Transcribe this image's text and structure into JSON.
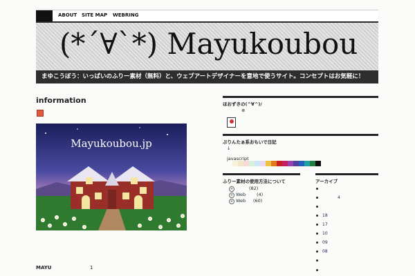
{
  "nav": {
    "items": [
      "ABOUT",
      "SITE MAP",
      "WEBRING"
    ]
  },
  "header": {
    "title": "(*´∀`*) Mayukoubou",
    "tagline": "まゆこうぼう：いっぱいのふりー素材（無料）と、ウェブアートデザイナーを意地で使うサイト。コンセプトはお気軽に！"
  },
  "main": {
    "heading": "information",
    "hero_text": "Mayukoubou.jp",
    "footer_label": "MAYU",
    "footer_num": "1"
  },
  "sidebar": {
    "widget1": {
      "title": "ほおずきの(^∀^)/",
      "plus": "⊕"
    },
    "widget2": {
      "title": "ぷりんたぁ系おもいで日記",
      "arrow": "↓",
      "script_label": "javascript"
    },
    "swatch_colors": [
      "#f6f2d8",
      "#f2e6c8",
      "#f9d8d8",
      "#d8f0d8",
      "#cfe6f6",
      "#e8d8f0",
      "#f0c040",
      "#e07a20",
      "#c82020",
      "#c02068",
      "#9a40b0",
      "#5040a0",
      "#2060c0",
      "#20a0a0",
      "#208040",
      "#111111"
    ],
    "widget3": {
      "title": "ふりー素材の使用方法について",
      "items": [
        {
          "label": "",
          "count": "(82)"
        },
        {
          "label": "Web",
          "count": "(4)"
        },
        {
          "label": "Web",
          "count": "(60)"
        }
      ]
    },
    "widget4": {
      "title": "アーカイブ",
      "numbers": [
        "4",
        "18",
        "17",
        "10",
        "09",
        "08"
      ]
    }
  },
  "colors": {
    "tagline_bg": "#2e2e2e",
    "accent": "#e25a3c"
  }
}
